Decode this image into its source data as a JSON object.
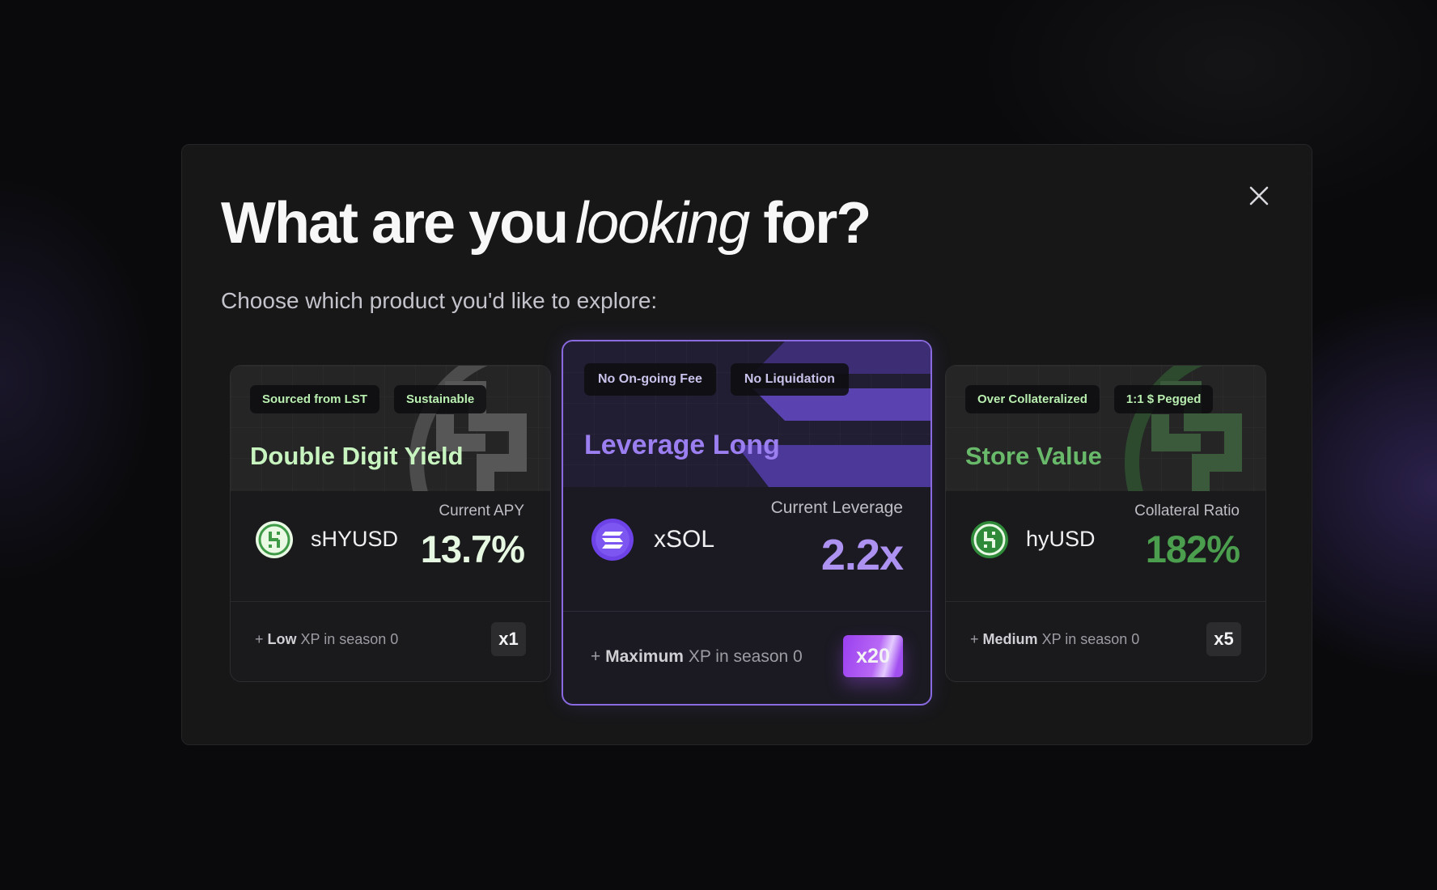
{
  "modal": {
    "title_pre": "What are you",
    "title_italic": "looking",
    "title_post": "for?",
    "subtitle": "Choose which product you'd like to explore:",
    "close_icon": "close-icon"
  },
  "cards": {
    "left": {
      "tags": [
        "Sourced from LST",
        "Sustainable"
      ],
      "title": "Double Digit Yield",
      "token": "sHYUSD",
      "token_icon": "hyusd-coin-icon",
      "metric_label": "Current APY",
      "metric_value": "13.7%",
      "xp_prefix": "+",
      "xp_level": "Low",
      "xp_suffix": "XP in season 0",
      "multiplier": "x1",
      "accent": "#c8f4c0"
    },
    "center": {
      "tags": [
        "No On-going Fee",
        "No Liquidation"
      ],
      "title": "Leverage Long",
      "token": "xSOL",
      "token_icon": "xsol-coin-icon",
      "metric_label": "Current Leverage",
      "metric_value": "2.2x",
      "xp_prefix": "+",
      "xp_level": "Maximum",
      "xp_suffix": "XP in season 0",
      "multiplier": "x20",
      "accent": "#9b7ef0",
      "selected": true
    },
    "right": {
      "tags": [
        "Over Collateralized",
        "1:1 $ Pegged"
      ],
      "title": "Store Value",
      "token": "hyUSD",
      "token_icon": "hyusd-coin-icon",
      "metric_label": "Collateral Ratio",
      "metric_value": "182%",
      "xp_prefix": "+",
      "xp_level": "Medium",
      "xp_suffix": "XP in season 0",
      "multiplier": "x5",
      "accent": "#69b96a"
    }
  }
}
